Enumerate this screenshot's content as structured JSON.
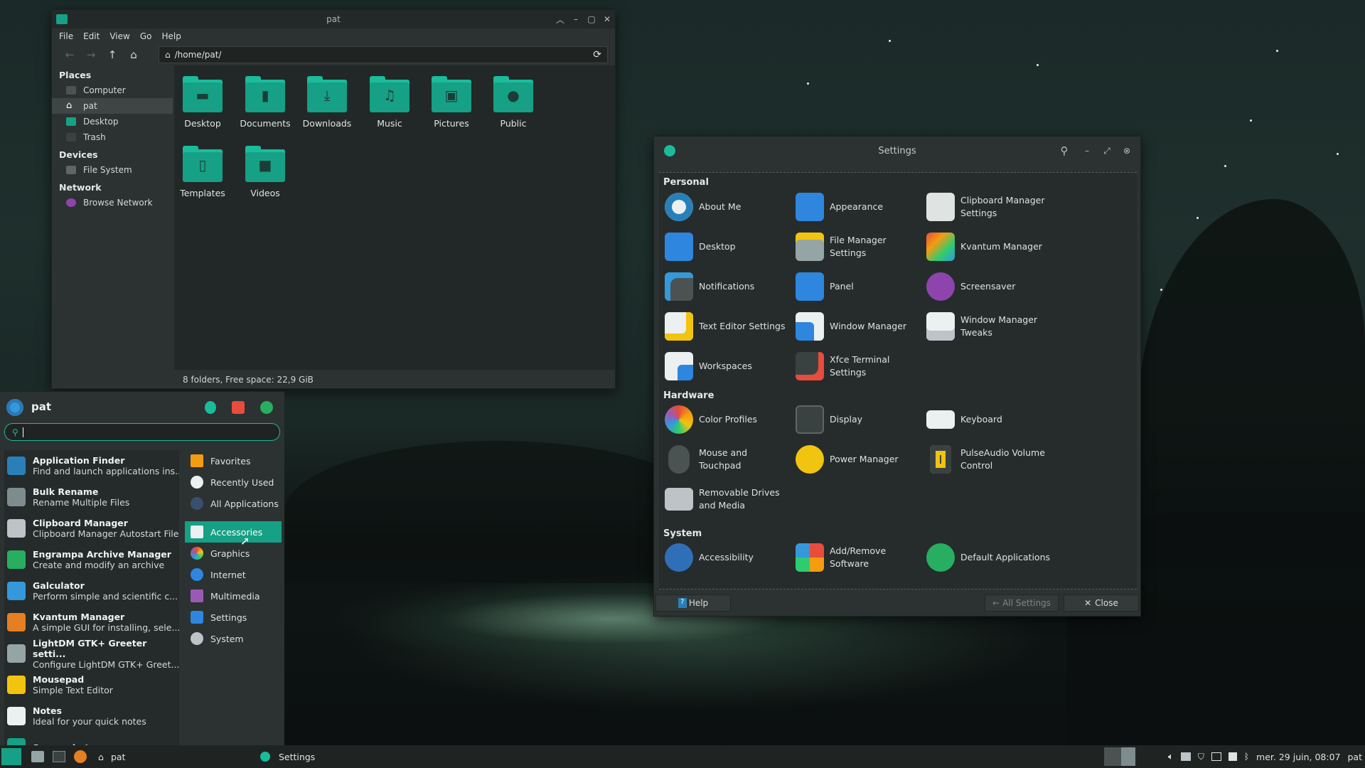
{
  "file_manager": {
    "title": "pat",
    "menu": [
      "File",
      "Edit",
      "View",
      "Go",
      "Help"
    ],
    "path": "/home/pat/",
    "sections": [
      {
        "label": "Places",
        "items": [
          "Computer",
          "pat",
          "Desktop",
          "Trash"
        ]
      },
      {
        "label": "Devices",
        "items": [
          "File System"
        ]
      },
      {
        "label": "Network",
        "items": [
          "Browse Network"
        ]
      }
    ],
    "folders": [
      "Desktop",
      "Documents",
      "Downloads",
      "Music",
      "Pictures",
      "Public",
      "Templates",
      "Videos"
    ],
    "status": "8 folders, Free space: 22,9 GiB"
  },
  "settings": {
    "title": "Settings",
    "sections": [
      {
        "label": "Personal",
        "items": [
          "About Me",
          "Appearance",
          "Clipboard Manager Settings",
          "Desktop",
          "File Manager Settings",
          "Kvantum Manager",
          "Notifications",
          "Panel",
          "Screensaver",
          "Text Editor Settings",
          "Window Manager",
          "Window Manager Tweaks",
          "Workspaces",
          "Xfce Terminal Settings"
        ]
      },
      {
        "label": "Hardware",
        "items": [
          "Color Profiles",
          "Display",
          "Keyboard",
          "Mouse and Touchpad",
          "Power Manager",
          "PulseAudio Volume Control",
          "Removable Drives and Media"
        ]
      },
      {
        "label": "System",
        "items": [
          "Accessibility",
          "Add/Remove Software",
          "Default Applications"
        ]
      }
    ],
    "help": "Help",
    "all_settings": "All Settings",
    "close": "Close"
  },
  "whisker": {
    "user": "pat",
    "apps": [
      {
        "name": "Application Finder",
        "desc": "Find and launch applications ins...",
        "color": "#2980b9"
      },
      {
        "name": "Bulk Rename",
        "desc": "Rename Multiple Files",
        "color": "#7f8c8d"
      },
      {
        "name": "Clipboard Manager",
        "desc": "Clipboard Manager Autostart File",
        "color": "#bdc3c7"
      },
      {
        "name": "Engrampa Archive Manager",
        "desc": "Create and modify an archive",
        "color": "#27ae60"
      },
      {
        "name": "Galculator",
        "desc": "Perform simple and scientific c...",
        "color": "#3498db"
      },
      {
        "name": "Kvantum Manager",
        "desc": "A simple GUI for installing, sele...",
        "color": "#e67e22"
      },
      {
        "name": "LightDM GTK+ Greeter setti...",
        "desc": "Configure LightDM GTK+ Greet...",
        "color": "#95a5a6"
      },
      {
        "name": "Mousepad",
        "desc": "Simple Text Editor",
        "color": "#f1c40f"
      },
      {
        "name": "Notes",
        "desc": "Ideal for your quick notes",
        "color": "#ecf0f1"
      },
      {
        "name": "Screenshot",
        "desc": "",
        "color": "#16a085"
      }
    ],
    "categories": [
      "Favorites",
      "Recently Used",
      "All Applications",
      "Accessories",
      "Graphics",
      "Internet",
      "Multimedia",
      "Settings",
      "System"
    ],
    "selected_category": "Accessories"
  },
  "taskbar": {
    "tasks": [
      "pat",
      "Settings"
    ],
    "clock": "mer. 29 juin, 08:07",
    "user": "pat"
  },
  "colors": {
    "accent": "#16a085",
    "accent_light": "#1abc9c"
  }
}
